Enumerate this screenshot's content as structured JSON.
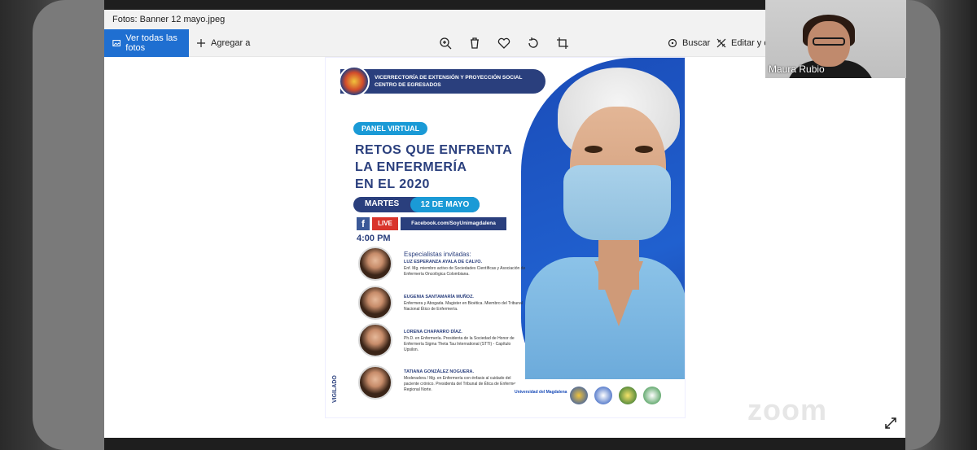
{
  "window": {
    "title": "Fotos: Banner 12 mayo.jpeg"
  },
  "toolbar": {
    "see_all_label": "Ver todas las fotos",
    "add_label": "Agregar a",
    "search_label": "Buscar",
    "edit_label": "Editar y cre"
  },
  "banner": {
    "header_line1": "VICERRECTORÍA DE EXTENSIÓN Y PROYECCIÓN SOCIAL",
    "header_line2": "CENTRO DE EGRESADOS",
    "panel_label": "PANEL VIRTUAL",
    "title_line1": "RETOS QUE ENFRENTA",
    "title_line2": "LA ENFERMERÍA",
    "title_line3": "EN EL 2020",
    "day": "MARTES",
    "date": "12 DE MAYO",
    "fb_icon": "f",
    "live": "LIVE",
    "fb_url": "Facebook.com/SoyUnimagdalena",
    "time": "4:00 PM",
    "specialists_heading": "Especialistas invitadas:",
    "vigilado": "VIGILADO",
    "people": [
      {
        "name": "LUZ ESPERANZA AYALA DE CALVO.",
        "desc": "Enf. Mg. miembro activo de Sociedades Científicas y Asociación de Enfermería Oncológica Colombiana."
      },
      {
        "name": "EUGENIA SANTAMARÍA MUÑOZ.",
        "desc": "Enfermera y Abogada. Magister en Bioética. Miembro del Tribunal Nacional Ético de Enfermería."
      },
      {
        "name": "LORENA CHAPARRO DÍAZ.",
        "desc": "Ph.D. en Enfermería. Presidenta de la Sociedad de Honor de Enfermería Sigma Theta Tau International (STTI) - Capítulo Upsilon."
      },
      {
        "name": "TATIANA GONZÁLEZ NOGUERA.",
        "desc": "Moderadora / Mg. en Enfermería con énfasis al cuidado del paciente crónico. Presidenta del Tribunal de Ética de Enfermería Regional Norte."
      }
    ],
    "sponsor_text": "Universidad del Magdalena"
  },
  "participant": {
    "name": "Maura Rubio"
  },
  "zoom": {
    "logo": "zoom"
  },
  "colors": {
    "accent_blue": "#1f6fd1",
    "banner_navy": "#2a3f7d",
    "banner_cyan": "#1a9ad6"
  }
}
